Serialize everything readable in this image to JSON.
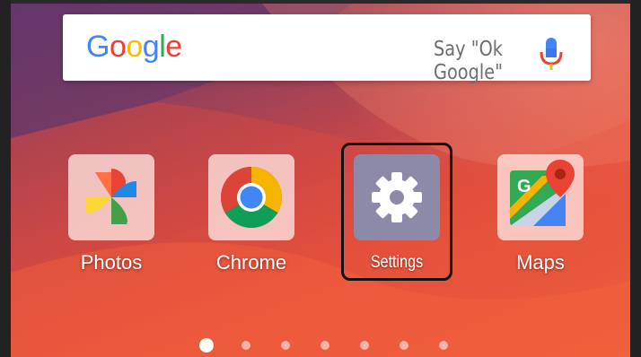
{
  "search": {
    "logo_letters": [
      {
        "char": "G",
        "color": "#4285F4"
      },
      {
        "char": "o",
        "color": "#EA4335"
      },
      {
        "char": "o",
        "color": "#FBBC05"
      },
      {
        "char": "g",
        "color": "#4285F4"
      },
      {
        "char": "l",
        "color": "#34A853"
      },
      {
        "char": "e",
        "color": "#EA4335"
      }
    ],
    "hint": "Say \"Ok Google\"",
    "mic_icon": "microphone-icon"
  },
  "apps": [
    {
      "label": "Photos",
      "icon": "google-photos-icon"
    },
    {
      "label": "Chrome",
      "icon": "chrome-icon"
    },
    {
      "label": "Settings",
      "icon": "gear-icon",
      "highlighted": true
    },
    {
      "label": "Maps",
      "icon": "google-maps-icon"
    }
  ],
  "page_indicator": {
    "total": 7,
    "active_index": 0
  },
  "colors": {
    "settings_tile": "#8c8aa8",
    "highlight_border": "#111111"
  }
}
